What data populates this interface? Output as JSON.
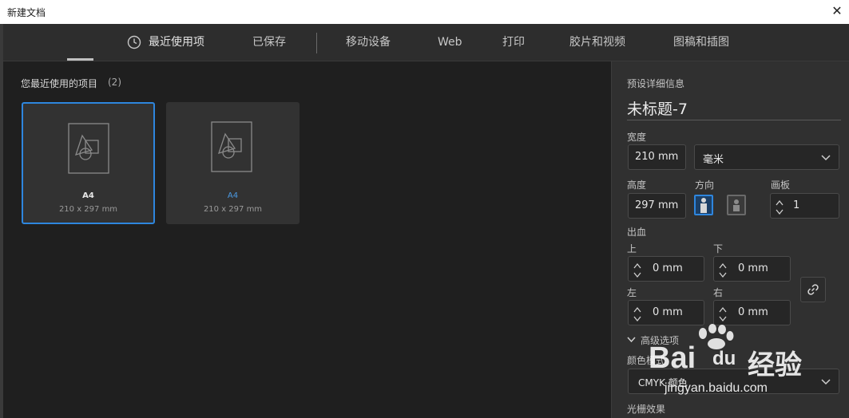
{
  "window": {
    "title": "新建文档",
    "close_glyph": "✕"
  },
  "tabs": [
    {
      "label": "最近使用项",
      "icon": "clock-icon"
    },
    {
      "label": "已保存"
    },
    {
      "label": "移动设备"
    },
    {
      "label": "Web"
    },
    {
      "label": "打印"
    },
    {
      "label": "胶片和视频"
    },
    {
      "label": "图稿和插图"
    }
  ],
  "recent": {
    "title": "您最近使用的项目",
    "count": "(2)",
    "items": [
      {
        "name": "A4",
        "size": "210 x 297 mm",
        "selected": true
      },
      {
        "name": "A4",
        "size": "210 x 297 mm",
        "selected": false
      }
    ]
  },
  "details": {
    "section_title": "预设详细信息",
    "doc_name": "未标题-7",
    "width_label": "宽度",
    "width_value": "210 mm",
    "unit_value": "毫米",
    "height_label": "高度",
    "height_value": "297 mm",
    "orientation_label": "方向",
    "artboard_label": "画板",
    "artboard_value": "1",
    "bleed_label": "出血",
    "top_label": "上",
    "top_value": "0 mm",
    "bottom_label": "下",
    "bottom_value": "0 mm",
    "left_label": "左",
    "left_value": "0 mm",
    "right_label": "右",
    "right_value": "0 mm",
    "advanced_label": "高级选项",
    "color_mode_label": "颜色模式",
    "color_mode_value": "CMYK 颜色",
    "raster_label": "光栅效果"
  },
  "watermark": {
    "brand": "Bai",
    "brand2": "du",
    "cn": "经验",
    "url": "jingyan.baidu.com"
  },
  "colors": {
    "accent": "#2e86de",
    "panel": "#303030",
    "background": "#1f1f1f"
  }
}
